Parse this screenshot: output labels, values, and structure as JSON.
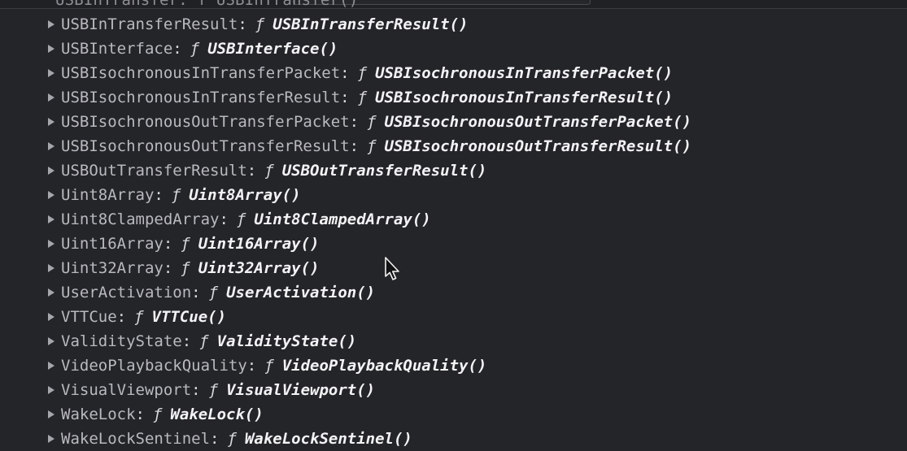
{
  "console": {
    "partial_top_text": "USBInTransfer: f USBInTransfer()",
    "entries": [
      {
        "key": "USBInTransferResult",
        "function_glyph": "ƒ",
        "value": "USBInTransferResult()"
      },
      {
        "key": "USBInterface",
        "function_glyph": "ƒ",
        "value": "USBInterface()"
      },
      {
        "key": "USBIsochronousInTransferPacket",
        "function_glyph": "ƒ",
        "value": "USBIsochronousInTransferPacket()"
      },
      {
        "key": "USBIsochronousInTransferResult",
        "function_glyph": "ƒ",
        "value": "USBIsochronousInTransferResult()"
      },
      {
        "key": "USBIsochronousOutTransferPacket",
        "function_glyph": "ƒ",
        "value": "USBIsochronousOutTransferPacket()"
      },
      {
        "key": "USBIsochronousOutTransferResult",
        "function_glyph": "ƒ",
        "value": "USBIsochronousOutTransferResult()"
      },
      {
        "key": "USBOutTransferResult",
        "function_glyph": "ƒ",
        "value": "USBOutTransferResult()"
      },
      {
        "key": "Uint8Array",
        "function_glyph": "ƒ",
        "value": "Uint8Array()"
      },
      {
        "key": "Uint8ClampedArray",
        "function_glyph": "ƒ",
        "value": "Uint8ClampedArray()"
      },
      {
        "key": "Uint16Array",
        "function_glyph": "ƒ",
        "value": "Uint16Array()"
      },
      {
        "key": "Uint32Array",
        "function_glyph": "ƒ",
        "value": "Uint32Array()"
      },
      {
        "key": "UserActivation",
        "function_glyph": "ƒ",
        "value": "UserActivation()"
      },
      {
        "key": "VTTCue",
        "function_glyph": "ƒ",
        "value": "VTTCue()"
      },
      {
        "key": "ValidityState",
        "function_glyph": "ƒ",
        "value": "ValidityState()"
      },
      {
        "key": "VideoPlaybackQuality",
        "function_glyph": "ƒ",
        "value": "VideoPlaybackQuality()"
      },
      {
        "key": "VisualViewport",
        "function_glyph": "ƒ",
        "value": "VisualViewport()"
      },
      {
        "key": "WakeLock",
        "function_glyph": "ƒ",
        "value": "WakeLock()"
      },
      {
        "key": "WakeLockSentinel",
        "function_glyph": "ƒ",
        "value": "WakeLockSentinel()"
      }
    ]
  },
  "colors": {
    "background": "#242528",
    "key_text": "#b9b9c0",
    "value_text": "#f3f3f5",
    "arrow": "#a6a6ad"
  },
  "icons": {
    "expand": "triangle-right-icon",
    "cursor": "mouse-pointer-icon"
  }
}
